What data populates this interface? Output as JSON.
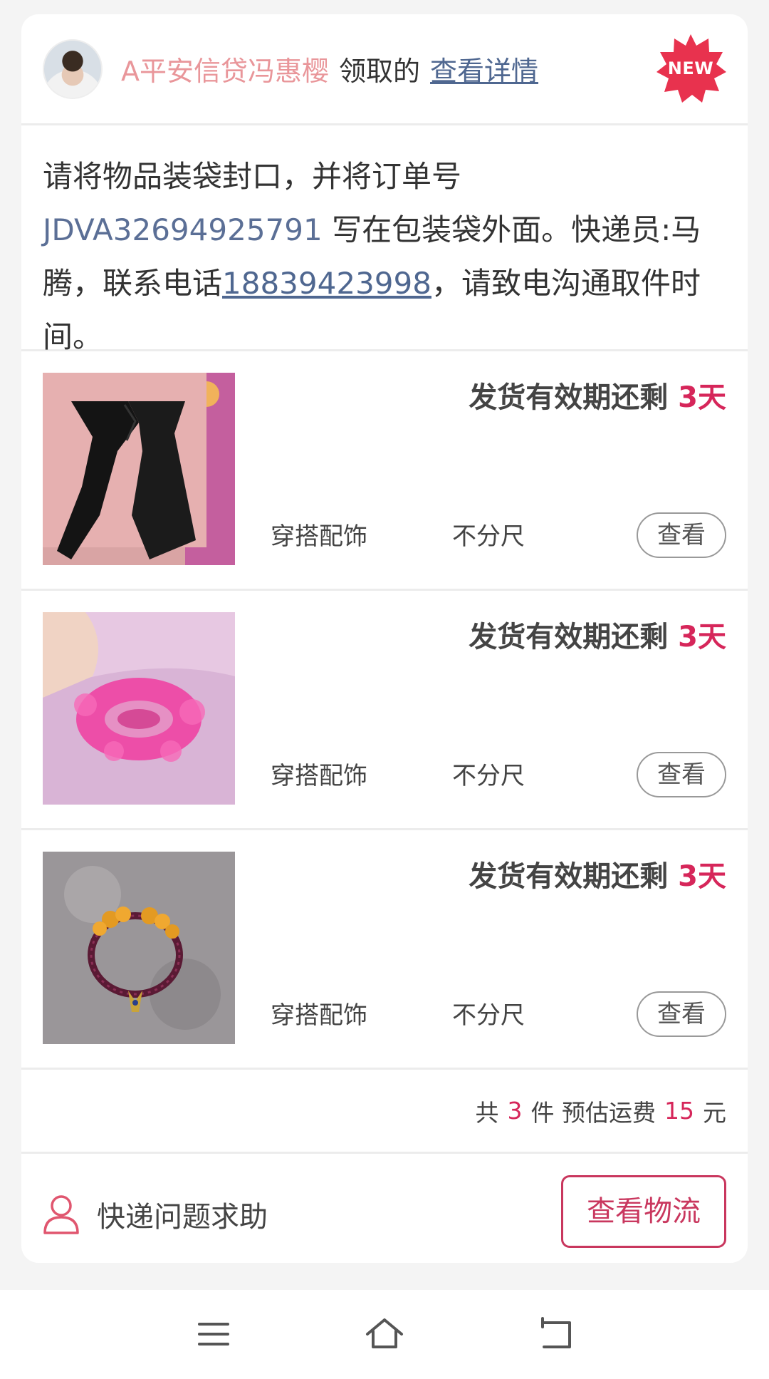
{
  "header": {
    "user_name": "A平安信贷冯惠樱",
    "claimed_text": "领取的",
    "detail_link": "查看详情",
    "badge": "NEW"
  },
  "notice": {
    "part1": "请将物品装袋封口，并将订单号 ",
    "order_no": "JDVA32694925791",
    "part2": " 写在包装袋外面。快递员:马腾，联系电话",
    "phone": "18839423998",
    "part3": "，请致电沟通取件时间。"
  },
  "items": [
    {
      "expire_label": "发货有效期还剩 ",
      "days": "3天",
      "category": "穿搭配饰",
      "size": "不分尺",
      "view": "查看",
      "image": "black-scarf"
    },
    {
      "expire_label": "发货有效期还剩 ",
      "days": "3天",
      "category": "穿搭配饰",
      "size": "不分尺",
      "view": "查看",
      "image": "pink-scrunchie"
    },
    {
      "expire_label": "发货有效期还剩 ",
      "days": "3天",
      "category": "穿搭配饰",
      "size": "不分尺",
      "view": "查看",
      "image": "bead-bracelet"
    }
  ],
  "summary": {
    "prefix": "共",
    "count": "3",
    "mid": "件  预估运费",
    "fee": "15",
    "suffix": "元"
  },
  "footer": {
    "help_label": "快递问题求助",
    "logistics_button": "查看物流"
  },
  "navbar": {
    "icons": [
      "menu-icon",
      "home-icon",
      "back-icon"
    ]
  },
  "colors": {
    "accent": "#d6265a",
    "link": "#4f6790",
    "username": "#e9969a",
    "button_border": "#c9375e"
  }
}
